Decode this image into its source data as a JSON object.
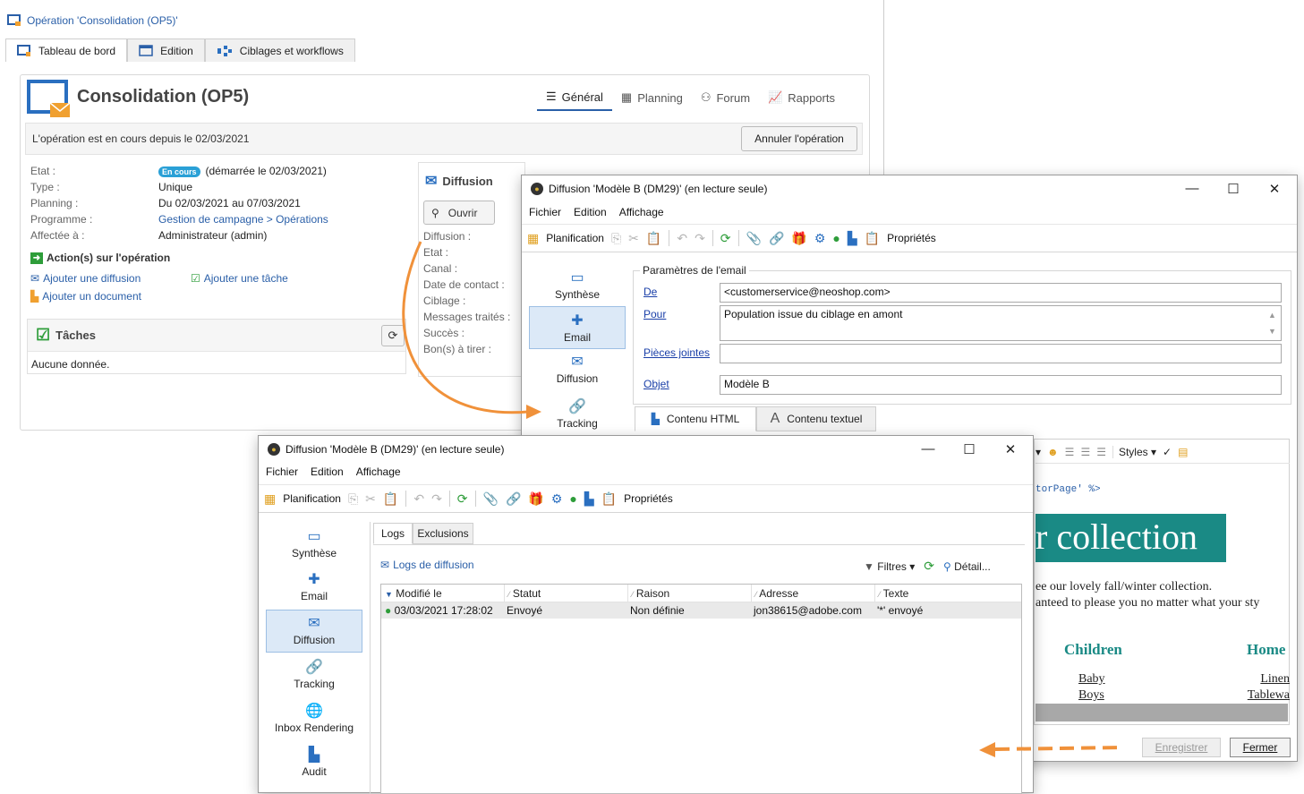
{
  "op_window": {
    "title": "Opération 'Consolidation (OP5)'",
    "tabs": [
      "Tableau de bord",
      "Edition",
      "Ciblages et workflows"
    ],
    "heading": "Consolidation (OP5)",
    "nav": [
      "Général",
      "Planning",
      "Forum",
      "Rapports"
    ],
    "status_text": "L'opération est en cours depuis le 02/03/2021",
    "cancel_button": "Annuler l'opération",
    "info": {
      "etat_label": "Etat :",
      "etat_badge": "En cours",
      "etat_value": "(démarrée le 02/03/2021)",
      "type_label": "Type :",
      "type_value": "Unique",
      "planning_label": "Planning :",
      "planning_value": "Du 02/03/2021 au 07/03/2021",
      "programme_label": "Programme :",
      "programme_value": "Gestion de campagne > Opérations",
      "affectee_label": "Affectée à :",
      "affectee_value": "Administrateur (admin)"
    },
    "actions_title": "Action(s) sur l'opération",
    "actions": [
      "Ajouter une diffusion",
      "Ajouter une tâche",
      "Ajouter un document"
    ],
    "tasks_title": "Tâches",
    "tasks_empty": "Aucune donnée.",
    "diffusion_panel": {
      "title": "Diffusion",
      "open_button": "Ouvrir",
      "labels": [
        "Diffusion :",
        "Etat :",
        "Canal :",
        "Date de contact :",
        "Ciblage :",
        "Messages traités :",
        "Succès :",
        "Bon(s) à tirer :"
      ]
    }
  },
  "email_window": {
    "title": "Diffusion 'Modèle B (DM29)' (en lecture seule)",
    "menu": [
      "Fichier",
      "Edition",
      "Affichage"
    ],
    "toolbar": {
      "planification": "Planification",
      "proprietes": "Propriétés"
    },
    "sidebar": [
      "Synthèse",
      "Email",
      "Diffusion",
      "Tracking"
    ],
    "group_title": "Paramètres de l'email",
    "fields": {
      "de_label": "De",
      "de_value": "<customerservice@neoshop.com>",
      "pour_label": "Pour",
      "pour_value": "Population issue du ciblage en amont",
      "pj_label": "Pièces jointes",
      "pj_value": "",
      "objet_label": "Objet",
      "objet_value": "Modèle B"
    },
    "content_tabs": [
      "Contenu HTML",
      "Contenu textuel"
    ],
    "editor": {
      "styles": "Styles",
      "code_snippet": "torPage' %>",
      "banner": "r collection",
      "line1": "ee our lovely fall/winter collection.",
      "line2": "anteed to please you no matter what your sty",
      "col1_title": "Children",
      "col1_items": [
        "Baby",
        "Boys"
      ],
      "col2_title": "Home",
      "col2_items": [
        "Linen",
        "Tablewa"
      ]
    },
    "buttons": {
      "save": "Enregistrer",
      "close": "Fermer"
    }
  },
  "logs_window": {
    "title": "Diffusion 'Modèle B (DM29)' (en lecture seule)",
    "menu": [
      "Fichier",
      "Edition",
      "Affichage"
    ],
    "toolbar": {
      "planification": "Planification",
      "proprietes": "Propriétés"
    },
    "sidebar": [
      "Synthèse",
      "Email",
      "Diffusion",
      "Tracking",
      "Inbox Rendering",
      "Audit"
    ],
    "tabs": [
      "Logs",
      "Exclusions"
    ],
    "logs_title": "Logs de diffusion",
    "filters": "Filtres",
    "detail": "Détail...",
    "columns": [
      "Modifié le",
      "Statut",
      "Raison",
      "Adresse",
      "Texte"
    ],
    "rows": [
      {
        "date": "03/03/2021 17:28:02",
        "statut": "Envoyé",
        "raison": "Non définie",
        "adresse": "jon38615@adobe.com",
        "texte": "'*' envoyé"
      }
    ]
  },
  "colors": {
    "accent": "#2a5fa8",
    "orange": "#f0913a",
    "selected": "#dce9f7",
    "banner": "#1a8a85"
  }
}
